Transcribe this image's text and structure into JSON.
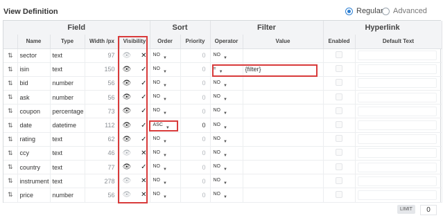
{
  "header": {
    "title": "View Definition",
    "mode_regular": "Regular",
    "mode_advanced": "Advanced",
    "selected_mode": "Regular"
  },
  "groups": {
    "field": "Field",
    "sort": "Sort",
    "filter": "Filter",
    "hyperlink": "Hyperlink"
  },
  "columns": {
    "name": "Name",
    "type": "Type",
    "width": "Width /px",
    "visibility": "Visibility",
    "order": "Order",
    "priority": "Priority",
    "operator": "Operator",
    "value": "Value",
    "enabled": "Enabled",
    "default_text": "Default Text"
  },
  "row_icon": "sort-az-icon",
  "rows": [
    {
      "name": "sector",
      "type": "text",
      "width": "97",
      "visible": false,
      "order": "NO",
      "priority": "0",
      "operator": "NO",
      "value": ""
    },
    {
      "name": "isin",
      "type": "text",
      "width": "150",
      "visible": true,
      "order": "NO",
      "priority": "0",
      "operator": "=",
      "value": "{filter}"
    },
    {
      "name": "bid",
      "type": "number",
      "width": "56",
      "visible": true,
      "order": "NO",
      "priority": "0",
      "operator": "NO",
      "value": ""
    },
    {
      "name": "ask",
      "type": "number",
      "width": "56",
      "visible": true,
      "order": "NO",
      "priority": "0",
      "operator": "NO",
      "value": ""
    },
    {
      "name": "coupon",
      "type": "percentage",
      "width": "73",
      "visible": true,
      "order": "NO",
      "priority": "0",
      "operator": "NO",
      "value": ""
    },
    {
      "name": "date",
      "type": "datetime",
      "width": "112",
      "visible": true,
      "order": "ASC",
      "priority": "0",
      "operator": "NO",
      "value": ""
    },
    {
      "name": "rating",
      "type": "text",
      "width": "62",
      "visible": true,
      "order": "NO",
      "priority": "0",
      "operator": "NO",
      "value": ""
    },
    {
      "name": "ccy",
      "type": "text",
      "width": "46",
      "visible": false,
      "order": "NO",
      "priority": "0",
      "operator": "NO",
      "value": ""
    },
    {
      "name": "country",
      "type": "text",
      "width": "77",
      "visible": true,
      "order": "NO",
      "priority": "0",
      "operator": "NO",
      "value": ""
    },
    {
      "name": "instrument",
      "type": "text",
      "width": "278",
      "visible": false,
      "order": "NO",
      "priority": "0",
      "operator": "NO",
      "value": ""
    },
    {
      "name": "price",
      "type": "number",
      "width": "56",
      "visible": false,
      "order": "NO",
      "priority": "0",
      "operator": "NO",
      "value": ""
    }
  ],
  "footer": {
    "limit_label": "LIMIT",
    "limit_value": "0"
  },
  "colors": {
    "highlight": "#d83a3a",
    "accent": "#2d7fd3",
    "header_bg": "#f3f4f6"
  }
}
